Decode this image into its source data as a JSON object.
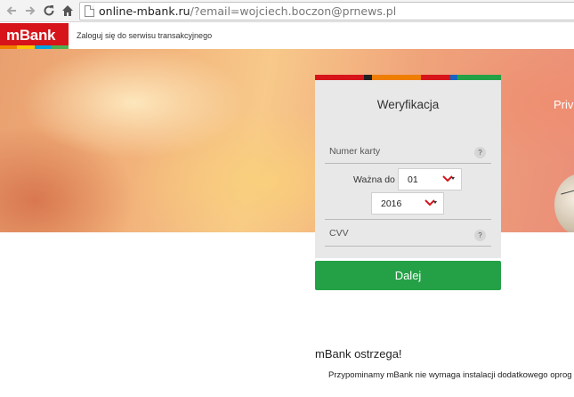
{
  "browser": {
    "url_host": "online-mbank.ru",
    "url_rest": "/?email=wojciech.boczon@prnews.pl"
  },
  "header": {
    "logo_text": "mBank",
    "logo_colors": [
      "#d7141a",
      "#e4002b",
      "#ef7d00",
      "#fdc300",
      "#00a3e0",
      "#4caf50"
    ],
    "title": "Zaloguj się do serwisu transakcyjnego"
  },
  "hero": {
    "text": "Priv"
  },
  "verification": {
    "title": "Weryfikacja",
    "stripe_colors": [
      "#d7141a",
      "#222222",
      "#ef7d00",
      "#d7141a",
      "#1565c0",
      "#24a146"
    ],
    "card_number_label": "Numer karty",
    "help_symbol": "?",
    "expiry_label": "Ważna do",
    "month_value": "01",
    "year_value": "2016",
    "cvv_label": "CVV",
    "submit_label": "Dalej",
    "submit_color": "#24a146"
  },
  "warning": {
    "heading": "mBank ostrzega!",
    "text": "Przypominamy mBank nie wymaga instalacji dodatkowego oprog"
  }
}
